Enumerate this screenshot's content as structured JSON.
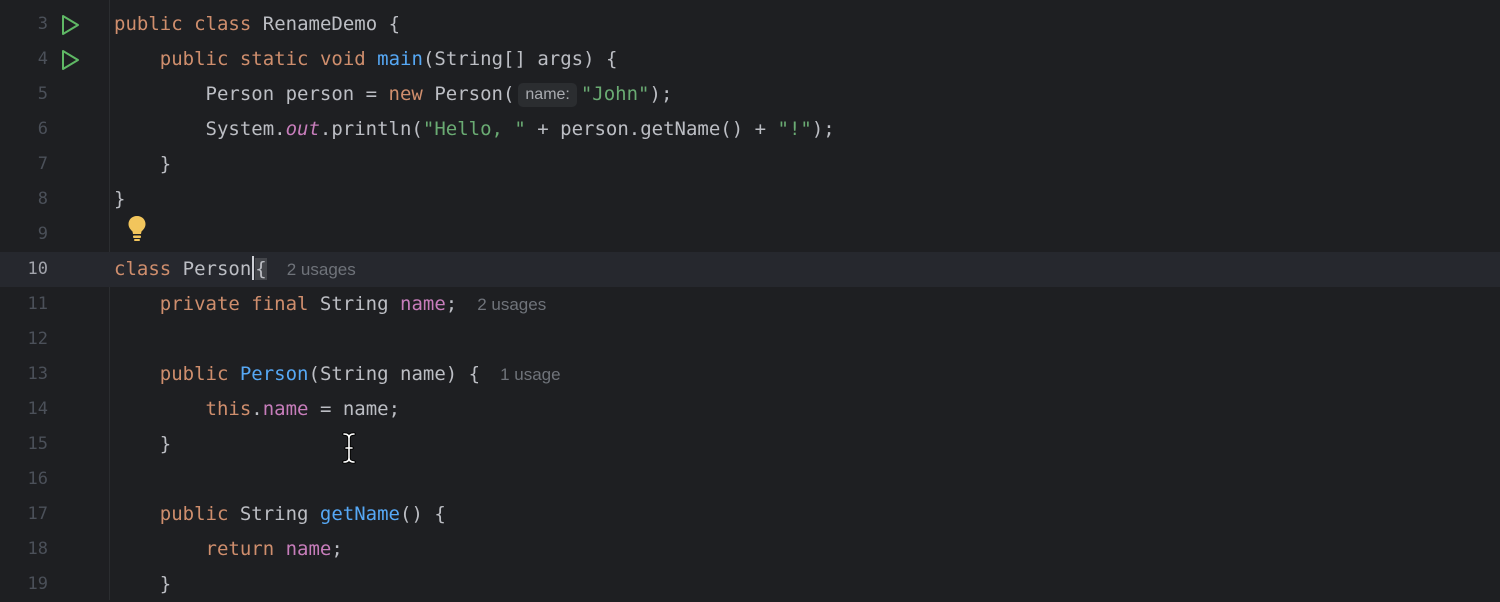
{
  "editor": {
    "current_line": "10",
    "cursor_icon": "i-beam-cursor-icon",
    "lines": {
      "l3": {
        "num": "3",
        "t1": "public",
        "t2": "class",
        "t3": "RenameDemo {",
        "run_icon": "run-icon"
      },
      "l4": {
        "num": "4",
        "t1": "public",
        "t2": "static",
        "t3": "void",
        "t4": "main",
        "t5": "(String[] args) {",
        "run_icon": "run-icon"
      },
      "l5": {
        "num": "5",
        "t1": "Person person = ",
        "t2": "new",
        "t3": " Person(",
        "hint": "name:",
        "t4": "\"John\"",
        "t5": ");"
      },
      "l6": {
        "num": "6",
        "t1": "System.",
        "t2": "out",
        "t3": ".println(",
        "t4": "\"Hello, \"",
        "t5": " + person.getName() + ",
        "t6": "\"!\"",
        "t7": ");"
      },
      "l7": {
        "num": "7",
        "t1": "}"
      },
      "l8": {
        "num": "8",
        "t1": "}"
      },
      "l9": {
        "num": "9",
        "bulb_icon": "lightbulb-icon"
      },
      "l10": {
        "num": "10",
        "t1": "class",
        "t2": " Person",
        "t3": "{",
        "usage": "2 usages"
      },
      "l11": {
        "num": "11",
        "t1": "private",
        "t2": " final",
        "t3": " String ",
        "t4": "name",
        "t5": ";",
        "usage": "2 usages"
      },
      "l12": {
        "num": "12"
      },
      "l13": {
        "num": "13",
        "t1": "public",
        "t2": "Person",
        "t3": "(String name) {",
        "usage": "1 usage"
      },
      "l14": {
        "num": "14",
        "t1": "this",
        "t2": ".",
        "t3": "name",
        "t4": " = name;"
      },
      "l15": {
        "num": "15",
        "t1": "}"
      },
      "l16": {
        "num": "16"
      },
      "l17": {
        "num": "17",
        "t1": "public",
        "t2": " String ",
        "t3": "getName",
        "t4": "() {"
      },
      "l18": {
        "num": "18",
        "t1": "return",
        "t2": " ",
        "t3": "name",
        "t4": ";"
      },
      "l19": {
        "num": "19",
        "t1": "}"
      }
    }
  },
  "colors": {
    "background": "#1e1f22",
    "keyword": "#cf8e6d",
    "function": "#56a8f5",
    "field": "#c77dbb",
    "string": "#6aab73",
    "run_icon": "#5fb865",
    "lightbulb": "#f2c55c"
  }
}
